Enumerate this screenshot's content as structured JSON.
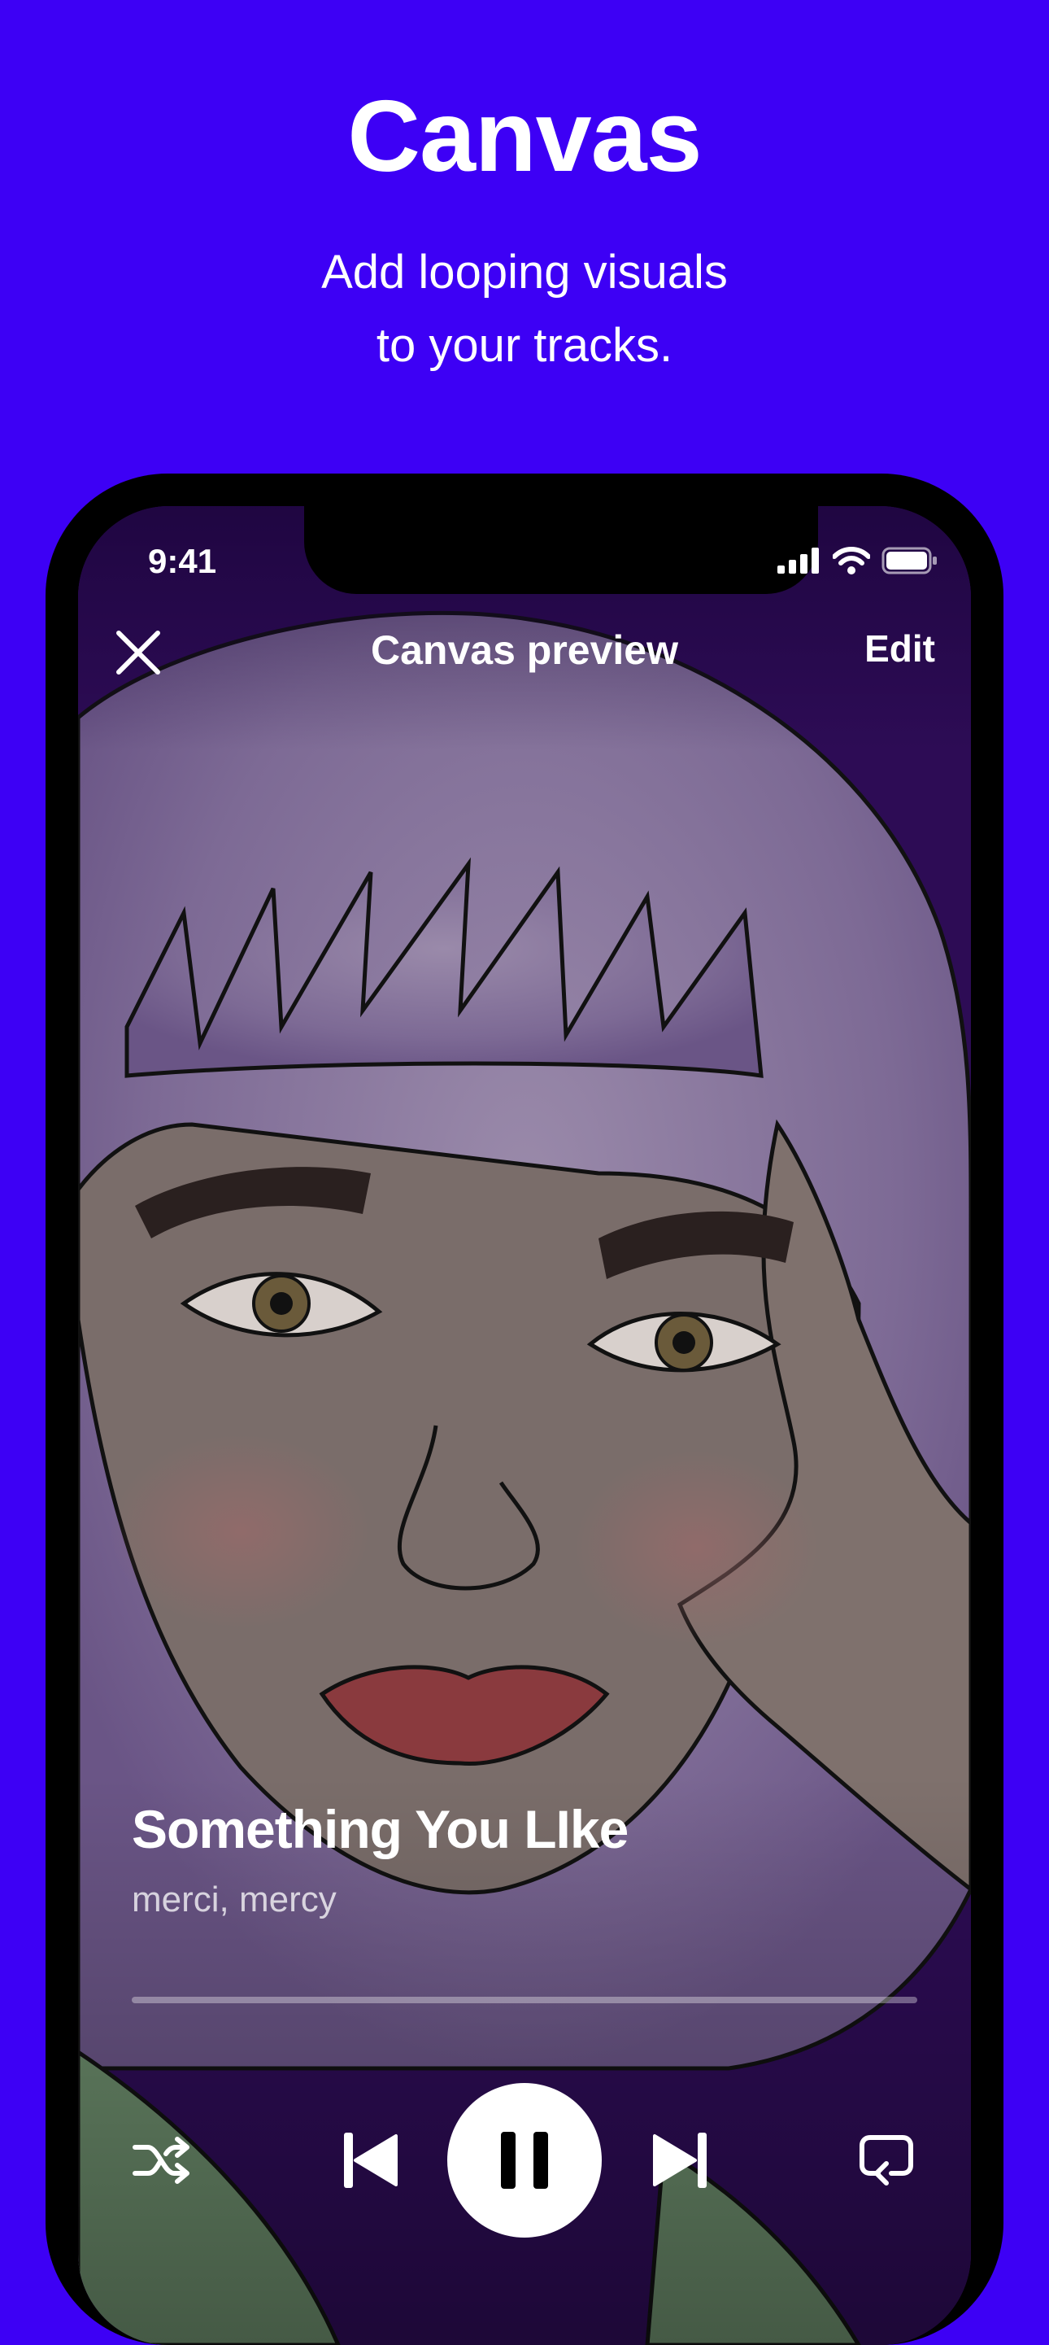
{
  "promo": {
    "title": "Canvas",
    "subtitle_line1": "Add looping visuals",
    "subtitle_line2": "to your tracks."
  },
  "status_bar": {
    "time": "9:41",
    "icons": [
      "signal-icon",
      "wifi-icon",
      "battery-icon"
    ]
  },
  "nav": {
    "close_icon": "close-icon",
    "title": "Canvas preview",
    "edit_label": "Edit"
  },
  "track": {
    "title": "Something You LIke",
    "artist": "merci, mercy",
    "progress": 0.0
  },
  "controls": {
    "icons": [
      "shuffle-icon",
      "skip-previous-icon",
      "pause-icon",
      "skip-next-icon",
      "repeat-icon"
    ]
  },
  "colors": {
    "background": "#3d00f5",
    "canvas_background": "#2d0c55",
    "accent": "#ffffff"
  }
}
